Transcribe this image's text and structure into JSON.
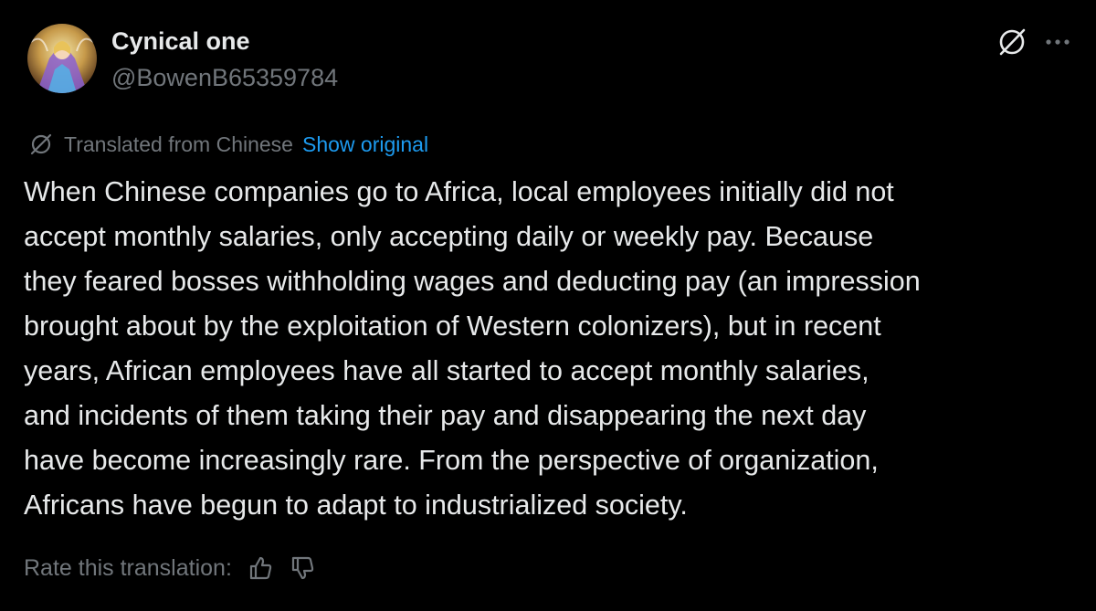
{
  "post": {
    "author": {
      "display_name": "Cynical one",
      "handle": "@BowenB65359784"
    },
    "translation_notice": {
      "label": "Translated from Chinese",
      "show_original": "Show original"
    },
    "text_lines": [
      "When Chinese companies go to Africa, local employees initially did not",
      "accept monthly salaries, only accepting daily or weekly pay. Because",
      "they feared bosses withholding wages and deducting pay (an impression",
      "brought about by the exploitation of Western colonizers), but in recent",
      "years, African employees have all started to accept monthly salaries,",
      "and incidents of them taking their pay and disappearing the next day",
      "have become increasingly rare. From the perspective of organization,",
      "Africans have begun to adapt to industrialized society."
    ],
    "rate_translation": {
      "label": "Rate this translation:"
    },
    "icons": {
      "header_right": [
        "grok-icon",
        "more-options-icon"
      ],
      "translation": "translate-icon",
      "rating": [
        "thumbs-up-icon",
        "thumbs-down-icon"
      ]
    }
  },
  "colors": {
    "background": "#000000",
    "primary_text": "#e7e9ea",
    "secondary_text": "#71767b",
    "link": "#1d9bf0"
  }
}
